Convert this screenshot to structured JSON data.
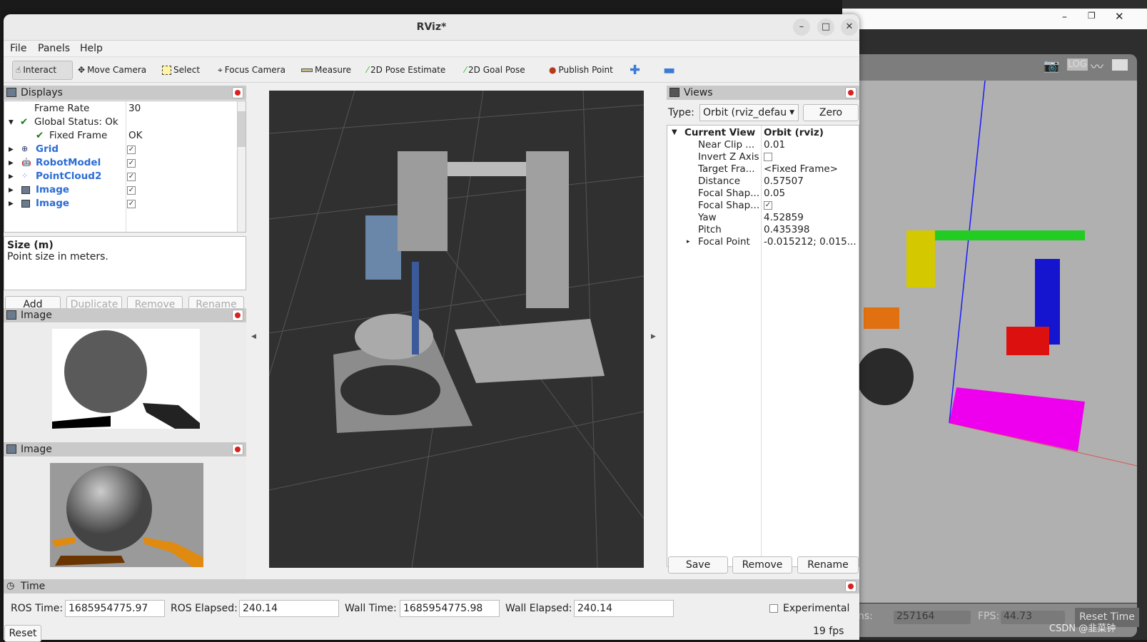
{
  "window": {
    "title": "RViz*"
  },
  "menu": [
    "File",
    "Panels",
    "Help"
  ],
  "toolbar": [
    {
      "label": "Interact",
      "icon": "hand-icon",
      "active": true
    },
    {
      "label": "Move Camera",
      "icon": "move-icon"
    },
    {
      "label": "Select",
      "icon": "select-icon"
    },
    {
      "label": "Focus Camera",
      "icon": "crosshair-icon"
    },
    {
      "label": "Measure",
      "icon": "ruler-icon"
    },
    {
      "label": "2D Pose Estimate",
      "icon": "green-arrow-icon"
    },
    {
      "label": "2D Goal Pose",
      "icon": "green-arrow-icon"
    },
    {
      "label": "Publish Point",
      "icon": "map-pin-icon"
    }
  ],
  "displays": {
    "title": "Displays",
    "rows": [
      {
        "name": "Frame Rate",
        "value": "30"
      },
      {
        "name": "Global Status: Ok",
        "value": ""
      },
      {
        "name": "Fixed Frame",
        "value": "OK"
      },
      {
        "name": "Grid",
        "checked": true
      },
      {
        "name": "RobotModel",
        "checked": true
      },
      {
        "name": "PointCloud2",
        "checked": true
      },
      {
        "name": "Image",
        "checked": true
      },
      {
        "name": "Image",
        "checked": true
      }
    ],
    "desc_title": "Size (m)",
    "desc_text": "Point size in meters.",
    "buttons": [
      "Add",
      "Duplicate",
      "Remove",
      "Rename"
    ]
  },
  "image_panels": [
    {
      "title": "Image"
    },
    {
      "title": "Image"
    }
  ],
  "views": {
    "title": "Views",
    "type_label": "Type:",
    "type_value": "Orbit (rviz_defau",
    "zero": "Zero",
    "current_view": "Current View",
    "current_value": "Orbit (rviz)",
    "props": [
      {
        "name": "Near Clip ...",
        "value": "0.01"
      },
      {
        "name": "Invert Z Axis",
        "value": "",
        "checkbox": false
      },
      {
        "name": "Target Fra...",
        "value": "<Fixed Frame>"
      },
      {
        "name": "Distance",
        "value": "0.57507"
      },
      {
        "name": "Focal Shap...",
        "value": "0.05"
      },
      {
        "name": "Focal Shap...",
        "value": "",
        "checkbox": true
      },
      {
        "name": "Yaw",
        "value": "4.52859"
      },
      {
        "name": "Pitch",
        "value": "0.435398"
      },
      {
        "name": "Focal Point",
        "value": "-0.015212; 0.015..."
      }
    ],
    "buttons": [
      "Save",
      "Remove",
      "Rename"
    ]
  },
  "time": {
    "title": "Time",
    "ros_time_label": "ROS Time:",
    "ros_time": "1685954775.97",
    "ros_elapsed_label": "ROS Elapsed:",
    "ros_elapsed": "240.14",
    "wall_time_label": "Wall Time:",
    "wall_time": "1685954775.98",
    "wall_elapsed_label": "Wall Elapsed:",
    "wall_elapsed": "240.14",
    "experimental": "Experimental",
    "reset": "Reset",
    "fps": "19 fps"
  },
  "background_app": {
    "iterations_label": "tions:",
    "iterations": "257164",
    "fps_label": "FPS:",
    "fps": "44.73",
    "reset_time": "Reset Time",
    "watermark": "CSDN @韭菜钟"
  }
}
